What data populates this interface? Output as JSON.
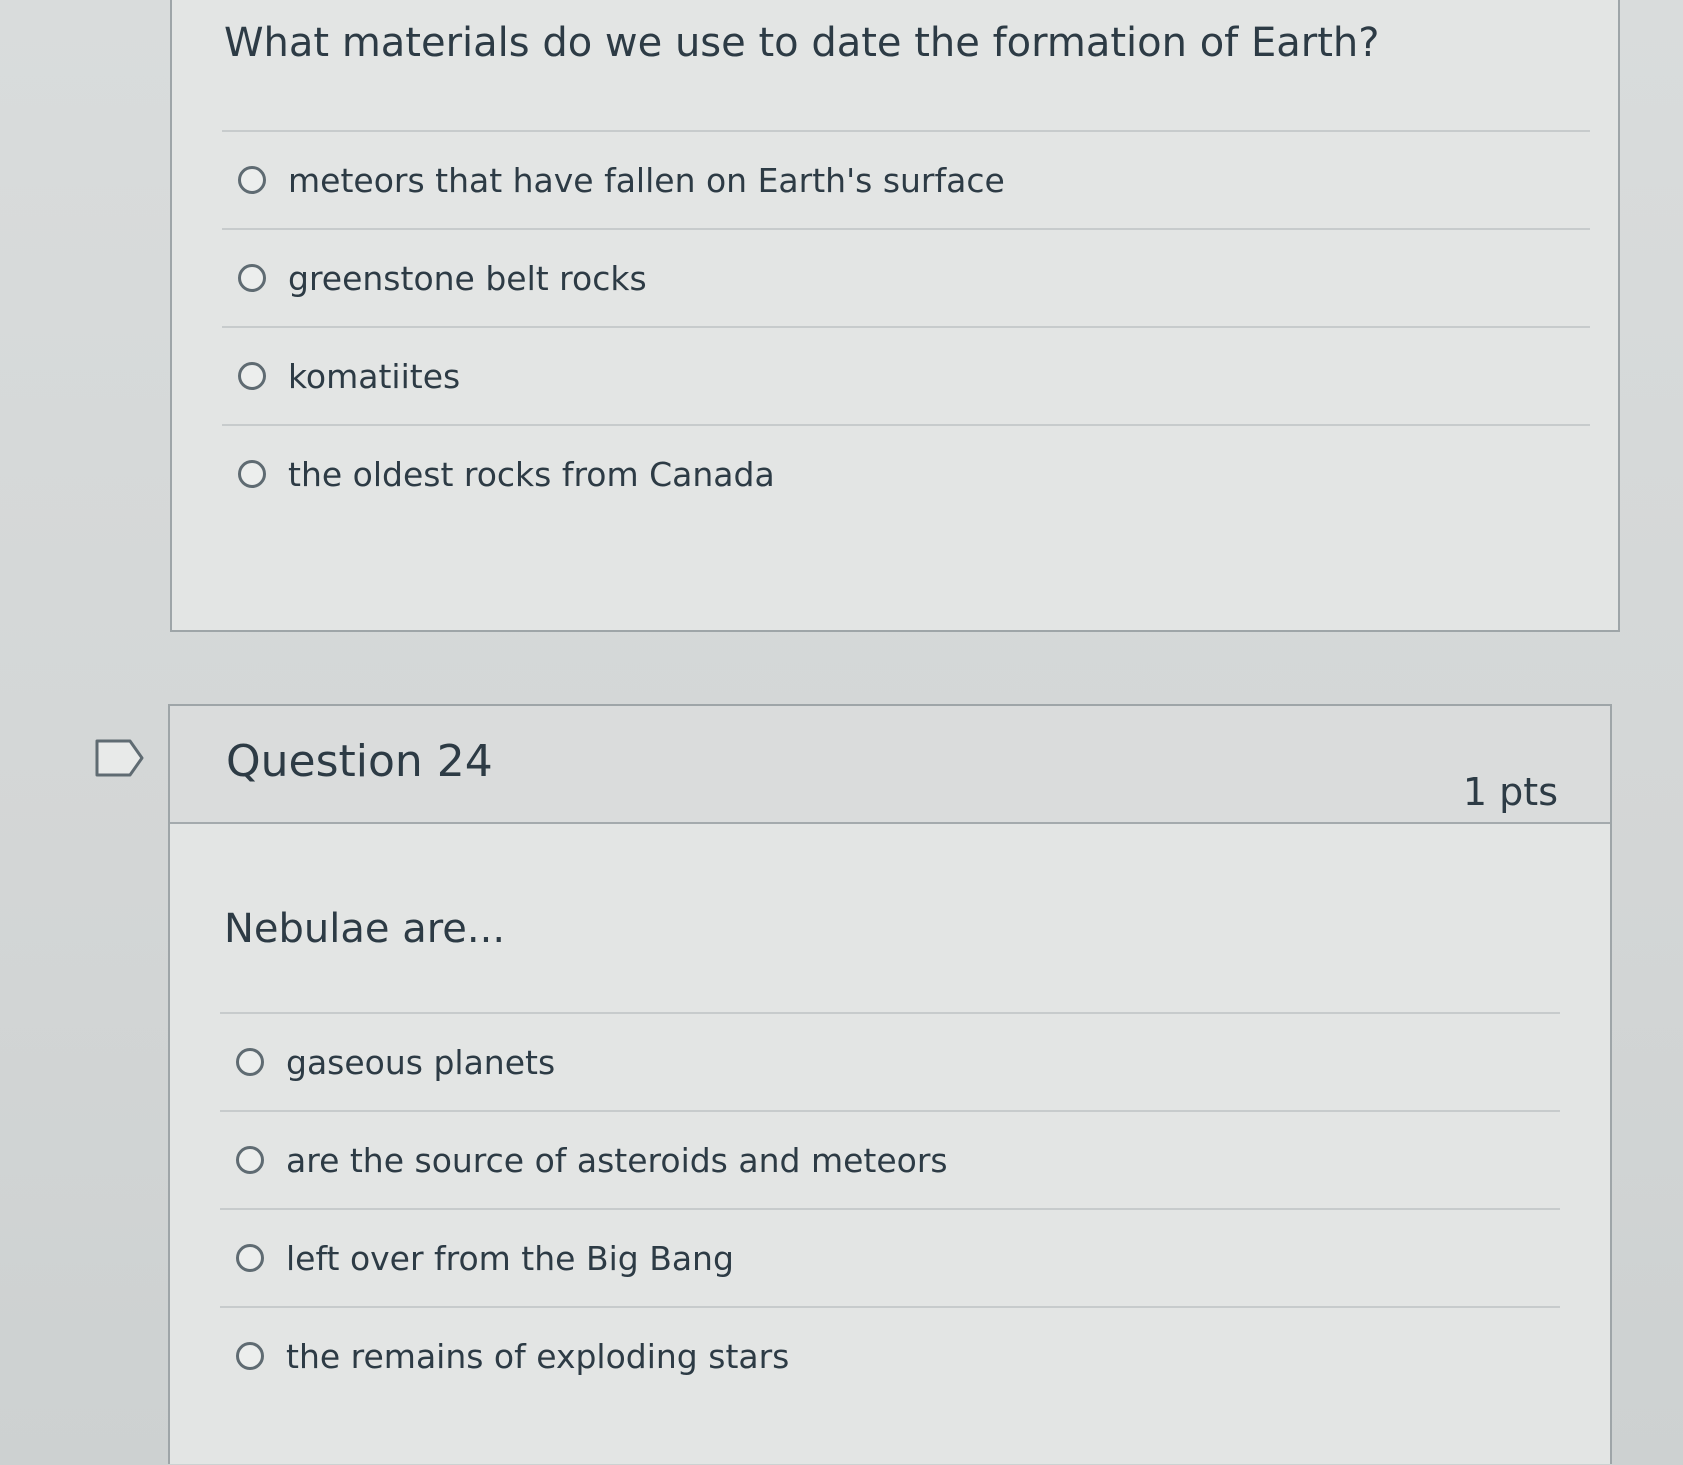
{
  "question_23": {
    "text": "What materials do we use to date the formation of Earth?",
    "answers": [
      "meteors that have fallen on Earth's surface",
      "greenstone belt rocks",
      "komatiites",
      "the oldest rocks from Canada"
    ]
  },
  "question_24": {
    "title": "Question 24",
    "points": "1 pts",
    "text": "Nebulae are...",
    "answers": [
      "gaseous planets",
      "are the source of asteroids and meteors",
      "left over from the Big Bang",
      "the remains of exploding stars"
    ]
  },
  "icons": {
    "flag": "flag-question-icon",
    "radio": "radio-button-icon"
  }
}
